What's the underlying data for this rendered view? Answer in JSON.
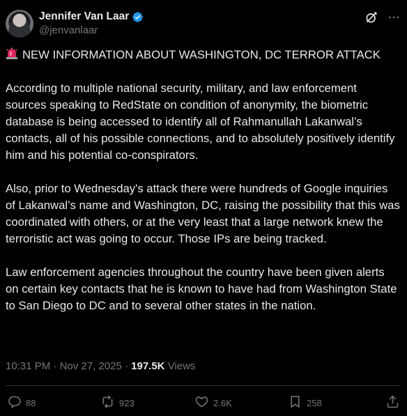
{
  "author": {
    "display_name": "Jennifer Van Laar",
    "handle": "@jenvanlaar",
    "verified": true
  },
  "icons": {
    "verified": "verified-badge-icon",
    "grok": "grok-icon",
    "more": "more-icon",
    "siren": "siren-emoji-icon"
  },
  "colors": {
    "background": "#000000",
    "text": "#e7e9ea",
    "muted": "#71767b",
    "verified": "#1d9bf0",
    "divider": "#2f3336"
  },
  "tweet": {
    "headline": "NEW INFORMATION ABOUT WASHINGTON, DC TERROR ATTACK",
    "paragraphs": [
      "According to multiple national security, military, and law enforcement sources speaking to RedState on condition of anonymity, the biometric database is being accessed to identify all of Rahmanullah Lakanwal’s contacts, all of his possible connections, and to absolutely positively identify him and his potential co-conspirators.",
      "Also, prior to Wednesday's attack there were hundreds of Google inquiries of Lakanwal’s name and Washington, DC, raising the possibility that this was coordinated with others, or at the very least that a large network knew the terroristic act was going to occur. Those IPs are being tracked.",
      "Law enforcement agencies throughout the country have been given alerts on certain key contacts that he is known to have had from Washington State to San Diego to DC and to several other states in the nation."
    ]
  },
  "meta": {
    "time": "10:31 PM",
    "date": "Nov 27, 2025",
    "separator": "·",
    "views_count": "197.5K",
    "views_label": "Views"
  },
  "actions": {
    "replies": {
      "icon": "reply-icon",
      "count": "88"
    },
    "reposts": {
      "icon": "repost-icon",
      "count": "923"
    },
    "likes": {
      "icon": "like-icon",
      "count": "2.6K"
    },
    "bookmarks": {
      "icon": "bookmark-icon",
      "count": "258"
    },
    "share": {
      "icon": "share-icon"
    }
  }
}
